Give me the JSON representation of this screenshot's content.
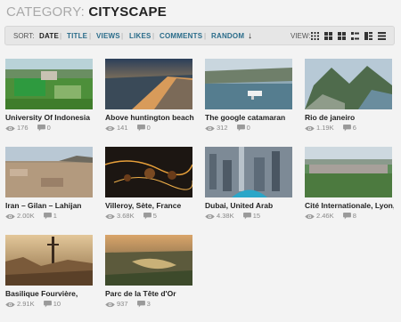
{
  "header": {
    "prefix": "CATEGORY:",
    "name": "CITYSCAPE"
  },
  "sortbar": {
    "sort_label": "SORT:",
    "items": [
      "DATE",
      "TITLE",
      "VIEWS",
      "LIKES",
      "COMMENTS",
      "RANDOM"
    ],
    "active": "DATE",
    "view_label": "VIEW:"
  },
  "videos": [
    {
      "title": "University Of Indonesia",
      "views": "176",
      "comments": "0"
    },
    {
      "title": "Above huntington beach",
      "views": "141",
      "comments": "0"
    },
    {
      "title": "The google catamaran",
      "views": "312",
      "comments": "0"
    },
    {
      "title": "Rio de janeiro",
      "views": "1.19K",
      "comments": "6"
    },
    {
      "title": "Iran – Gilan – Lahijan",
      "views": "2.00K",
      "comments": "1"
    },
    {
      "title": "Villeroy, Sète, France",
      "views": "3.68K",
      "comments": "5"
    },
    {
      "title": "Dubai, United Arab",
      "views": "4.38K",
      "comments": "15"
    },
    {
      "title": "Cité Internationale, Lyon,",
      "views": "2.46K",
      "comments": "8"
    },
    {
      "title": "Basilique Fourvière,",
      "views": "2.91K",
      "comments": "10"
    },
    {
      "title": "Parc de la Tête d'Or",
      "views": "937",
      "comments": "3"
    }
  ]
}
